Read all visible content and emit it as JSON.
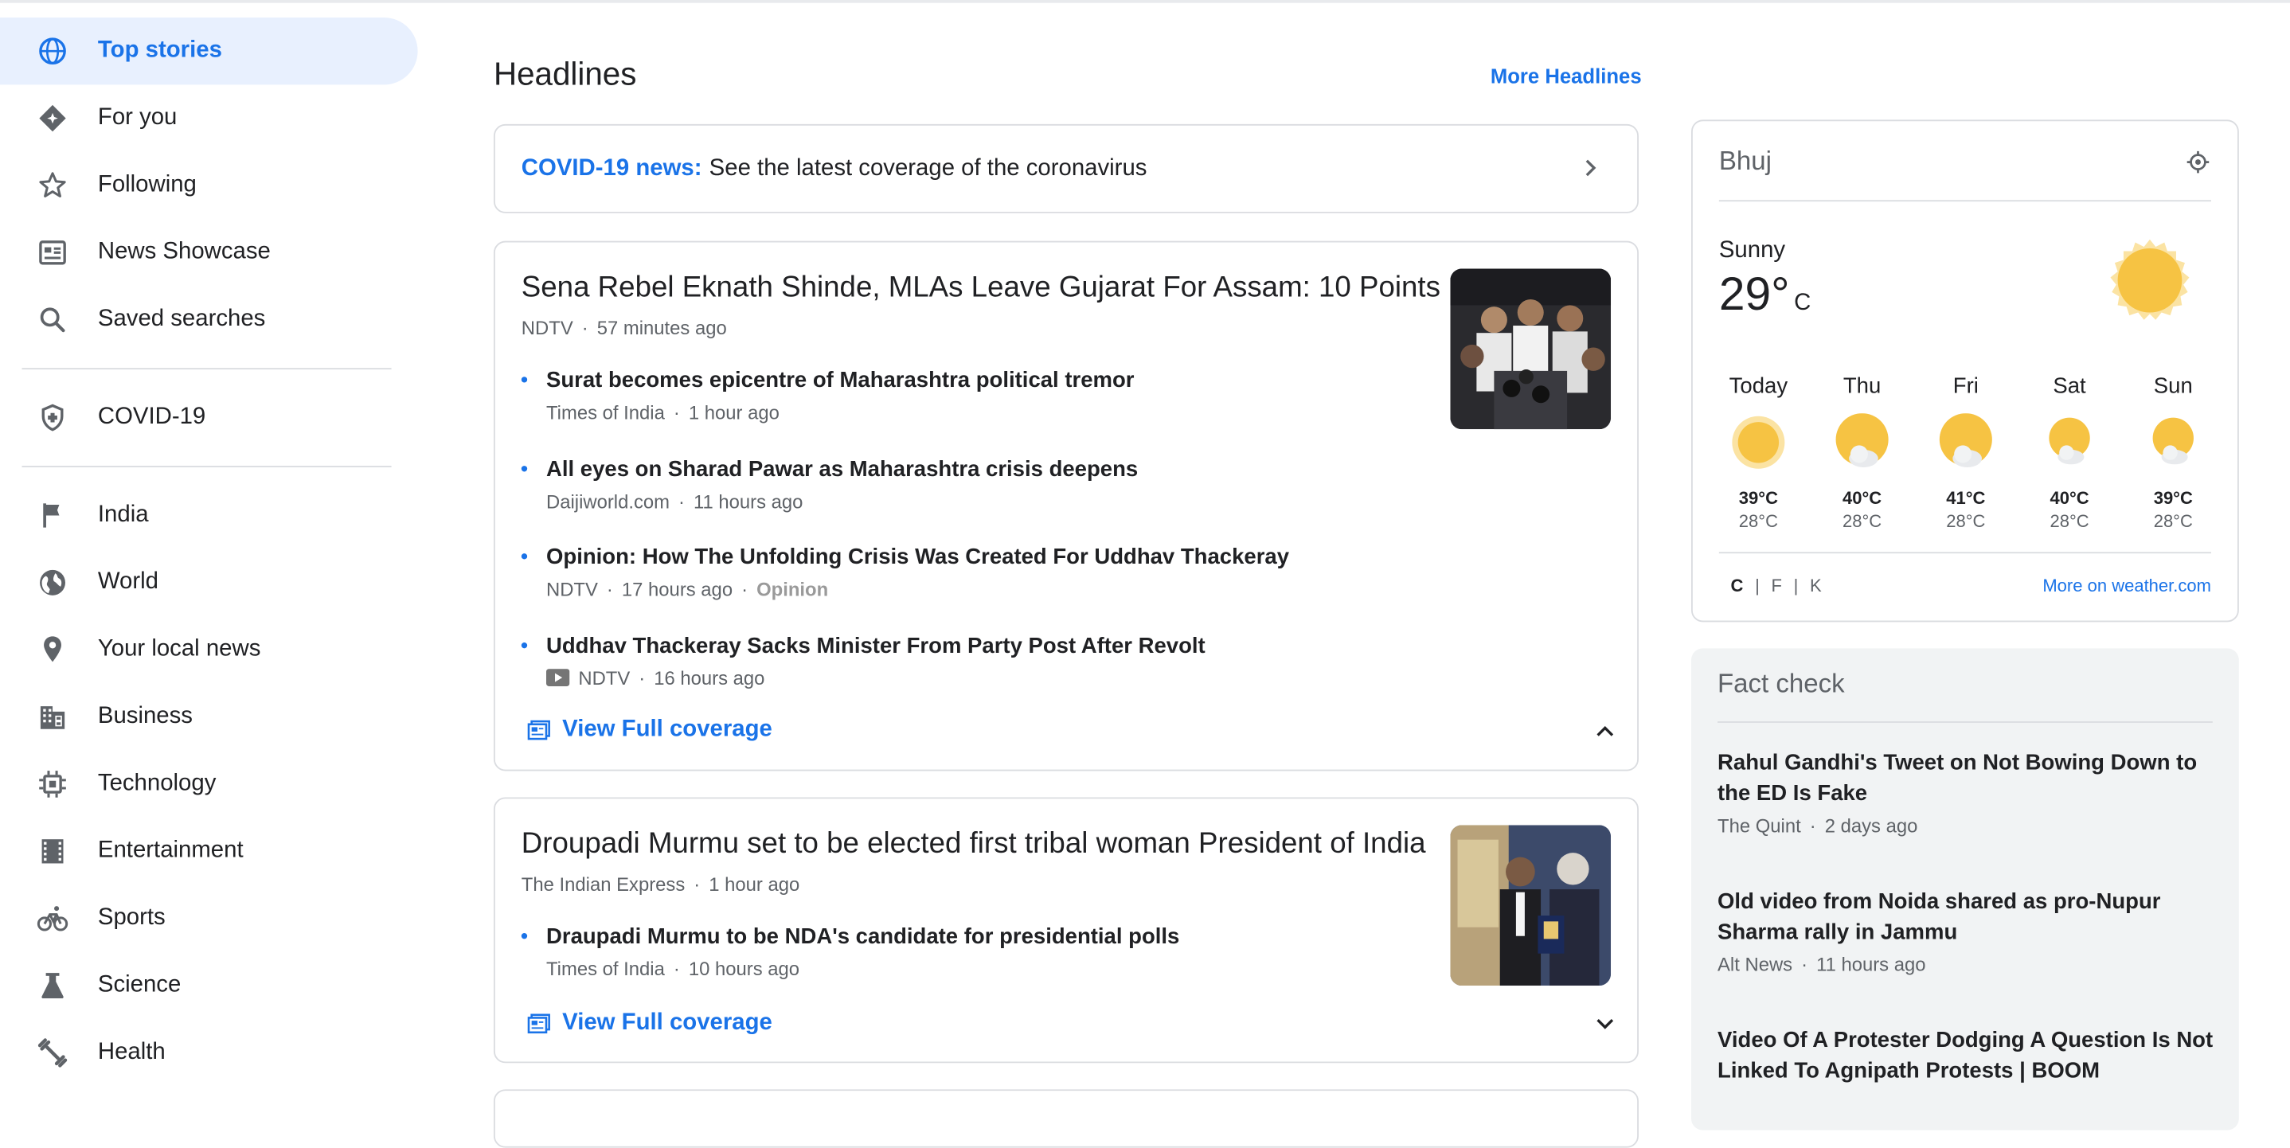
{
  "sidebar": {
    "items": [
      {
        "label": "Top stories",
        "icon": "globe-icon"
      },
      {
        "label": "For you",
        "icon": "diamond-star-icon"
      },
      {
        "label": "Following",
        "icon": "star-icon"
      },
      {
        "label": "News Showcase",
        "icon": "newspaper-icon"
      },
      {
        "label": "Saved searches",
        "icon": "search-icon"
      },
      {
        "label": "COVID-19",
        "icon": "shield-cross-icon"
      },
      {
        "label": "India",
        "icon": "flag-icon"
      },
      {
        "label": "World",
        "icon": "world-icon"
      },
      {
        "label": "Your local news",
        "icon": "location-pin-icon"
      },
      {
        "label": "Business",
        "icon": "building-icon"
      },
      {
        "label": "Technology",
        "icon": "chip-icon"
      },
      {
        "label": "Entertainment",
        "icon": "film-icon"
      },
      {
        "label": "Sports",
        "icon": "bicycle-icon"
      },
      {
        "label": "Science",
        "icon": "flask-icon"
      },
      {
        "label": "Health",
        "icon": "dumbbell-icon"
      }
    ]
  },
  "main": {
    "title": "Headlines",
    "more_label": "More Headlines",
    "covid": {
      "lead": "COVID-19 news:",
      "text": "See the latest coverage of the coronavirus"
    },
    "stories": [
      {
        "title": "Sena Rebel Eknath Shinde, MLAs Leave Gujarat For Assam: 10 Points",
        "source": "NDTV",
        "time": "57 minutes ago",
        "related": [
          {
            "title": "Surat becomes epicentre of Maharashtra political tremor",
            "source": "Times of India",
            "time": "1 hour ago"
          },
          {
            "title": "All eyes on Sharad Pawar as Maharashtra crisis deepens",
            "source": "Daijiworld.com",
            "time": "11 hours ago"
          },
          {
            "title": "Opinion: How The Unfolding Crisis Was Created For Uddhav Thackeray",
            "source": "NDTV",
            "time": "17 hours ago",
            "tag": "Opinion"
          },
          {
            "title": "Uddhav Thackeray Sacks Minister From Party Post After Revolt",
            "source": "NDTV",
            "time": "16 hours ago"
          }
        ],
        "full_coverage": "View Full coverage"
      },
      {
        "title": "Droupadi Murmu set to be elected first tribal woman President of India",
        "source": "The Indian Express",
        "time": "1 hour ago",
        "related": [
          {
            "title": "Draupadi Murmu to be NDA's candidate for presidential polls",
            "source": "Times of India",
            "time": "10 hours ago"
          }
        ],
        "full_coverage": "View Full coverage"
      }
    ]
  },
  "weather": {
    "city": "Bhuj",
    "condition": "Sunny",
    "temp": "29°",
    "unit": "C",
    "forecast": [
      {
        "day": "Today",
        "hi": "39°C",
        "lo": "28°C"
      },
      {
        "day": "Thu",
        "hi": "40°C",
        "lo": "28°C"
      },
      {
        "day": "Fri",
        "hi": "41°C",
        "lo": "28°C"
      },
      {
        "day": "Sat",
        "hi": "40°C",
        "lo": "28°C"
      },
      {
        "day": "Sun",
        "hi": "39°C",
        "lo": "28°C"
      }
    ],
    "units": [
      "C",
      "F",
      "K"
    ],
    "more": "More on weather.com"
  },
  "factcheck": {
    "title": "Fact check",
    "items": [
      {
        "title": "Rahul Gandhi's Tweet on Not Bowing Down to the ED Is Fake",
        "source": "The Quint",
        "time": "2 days ago"
      },
      {
        "title": "Old video from Noida shared as pro-Nupur Sharma rally in Jammu",
        "source": "Alt News",
        "time": "11 hours ago"
      },
      {
        "title": "Video Of A Protester Dodging A Question Is Not Linked To Agnipath Protests | BOOM",
        "source": "",
        "time": ""
      }
    ]
  },
  "colors": {
    "accent": "#1a73e8",
    "sun": "#f6c343"
  }
}
